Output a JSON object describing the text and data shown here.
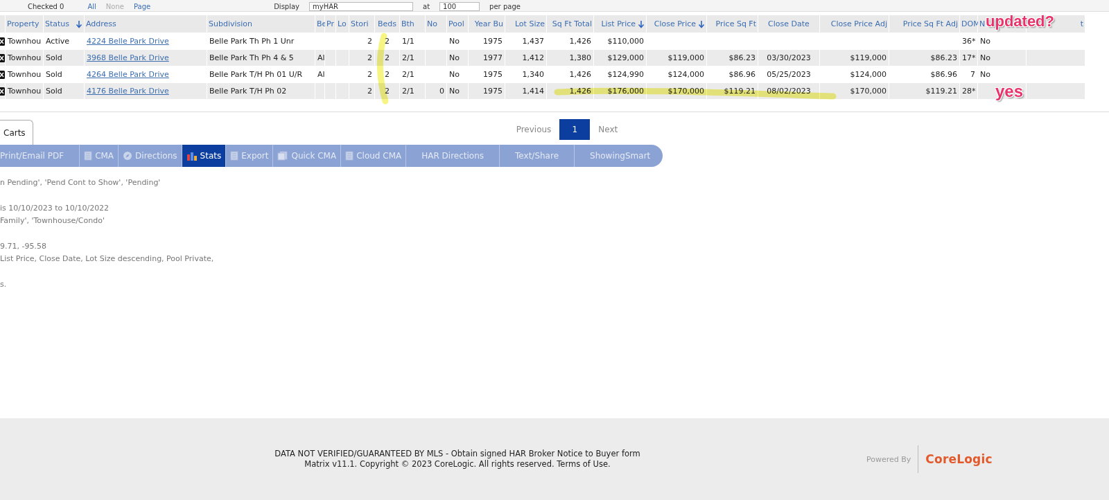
{
  "top_bar": {
    "checked_label": "Checked 0",
    "select_links": [
      "All",
      "None",
      "Page"
    ],
    "display_label": "Display",
    "display_value": "myHAR",
    "at_label": "at",
    "per_page_value": "100",
    "per_page_label": "per page"
  },
  "table": {
    "columns": [
      {
        "kind": "check",
        "sorted": false
      },
      {
        "label": "Property",
        "kind": "text",
        "sorted": false
      },
      {
        "label": "Status",
        "kind": "text",
        "sorted": true
      },
      {
        "label": "Address",
        "kind": "link",
        "sorted": false
      },
      {
        "label": "Subdivision",
        "kind": "text",
        "sorted": false
      },
      {
        "label": "Be",
        "kind": "text",
        "sorted": false
      },
      {
        "label": "Pr",
        "kind": "text",
        "sorted": false
      },
      {
        "label": "Lo",
        "kind": "text",
        "sorted": false
      },
      {
        "label": "Stori",
        "kind": "num",
        "sorted": false
      },
      {
        "label": "Beds",
        "kind": "center",
        "sorted": false
      },
      {
        "label": "Bth",
        "kind": "text",
        "sorted": false
      },
      {
        "label": "No",
        "kind": "num",
        "sorted": false
      },
      {
        "label": "Pool",
        "kind": "text",
        "sorted": false
      },
      {
        "label": "Year Bu",
        "kind": "num",
        "sorted": false
      },
      {
        "label": "Lot Size",
        "kind": "num",
        "sorted": false
      },
      {
        "label": "Sq Ft Total",
        "kind": "num",
        "sorted": false
      },
      {
        "label": "List Price",
        "kind": "num",
        "sorted": true
      },
      {
        "label": "Close Price",
        "kind": "num",
        "sorted": true
      },
      {
        "label": "Price Sq Ft",
        "kind": "num",
        "sorted": false
      },
      {
        "label": "Close Date",
        "kind": "center",
        "sorted": false
      },
      {
        "label": "Close Price Adj",
        "kind": "num",
        "sorted": false
      },
      {
        "label": "Price Sq Ft Adj",
        "kind": "num",
        "sorted": false
      },
      {
        "label": "DOM",
        "kind": "num",
        "sorted": false
      },
      {
        "label": "N",
        "kind": "text",
        "sorted": false
      },
      {
        "label": "t",
        "kind": "text",
        "sorted": false
      }
    ],
    "rows": [
      {
        "cells": [
          "",
          "Townhou",
          "Active",
          "4224 Belle Park Drive",
          "Belle Park Th Ph 1 Unr",
          "",
          "",
          "",
          "2",
          "2",
          "1/1",
          "",
          "No",
          "1975",
          "1,437",
          "1,426",
          "$110,000",
          "",
          "",
          "",
          "",
          "",
          "36*",
          "No",
          ""
        ]
      },
      {
        "cells": [
          "",
          "Townhou",
          "Sold",
          "3968 Belle Park Drive",
          "Belle Park Th Ph 4 & 5",
          "Al",
          "",
          "",
          "2",
          "2",
          "2/1",
          "",
          "No",
          "1977",
          "1,412",
          "1,380",
          "$129,000",
          "$119,000",
          "$86.23",
          "03/30/2023",
          "$119,000",
          "$86.23",
          "17*",
          "No",
          ""
        ]
      },
      {
        "cells": [
          "",
          "Townhou",
          "Sold",
          "4264 Belle Park Drive",
          "Belle Park T/H Ph 01 U/R",
          "Al",
          "",
          "",
          "2",
          "2",
          "2/1",
          "",
          "No",
          "1975",
          "1,340",
          "1,426",
          "$124,990",
          "$124,000",
          "$86.96",
          "05/25/2023",
          "$124,000",
          "$86.96",
          "7",
          "No",
          ""
        ]
      },
      {
        "cells": [
          "",
          "Townhou",
          "Sold",
          "4176 Belle Park Drive",
          "Belle Park T/H Ph 02",
          "",
          "",
          "",
          "2",
          "2",
          "2/1",
          "0",
          "No",
          "1975",
          "1,414",
          "1,426",
          "$176,000",
          "$170,000",
          "$119.21",
          "08/02/2023",
          "$170,000",
          "$119.21",
          "28*",
          "",
          ""
        ]
      }
    ]
  },
  "annotations": [
    {
      "text": "updated?"
    },
    {
      "text": "yes"
    }
  ],
  "tabs": [
    {
      "label": "Carts",
      "selected": true
    }
  ],
  "pager": {
    "previous": "Previous",
    "pages": [
      {
        "label": "1",
        "selected": true
      }
    ],
    "next": "Next"
  },
  "actions": [
    {
      "label": "Print/Email PDF",
      "kind": "plain",
      "selected": false
    },
    {
      "label": "CMA",
      "kind": "document",
      "selected": false
    },
    {
      "label": "Directions",
      "kind": "compass",
      "selected": false
    },
    {
      "label": "Stats",
      "kind": "chart",
      "selected": true
    },
    {
      "label": "Export",
      "kind": "document",
      "selected": false
    },
    {
      "label": "Quick CMA",
      "kind": "stack",
      "selected": false
    },
    {
      "label": "Cloud CMA",
      "kind": "document",
      "selected": false
    },
    {
      "label": "HAR Directions",
      "kind": "plain",
      "selected": false
    },
    {
      "label": "Text/Share",
      "kind": "plain",
      "selected": false
    },
    {
      "label": "ShowingSmart",
      "kind": "plain",
      "selected": false
    }
  ],
  "criteria": [
    [
      "n Pending', 'Pend Cont to Show', 'Pending'"
    ],
    [
      "is 10/10/2023 to 10/10/2022",
      "Family', 'Townhouse/Condo'"
    ],
    [
      "9.71, -95.58",
      "List Price, Close Date, Lot Size descending, Pool Private,"
    ],
    [
      "s."
    ]
  ],
  "footer": {
    "lines": [
      "DATA NOT VERIFIED/GUARANTEED BY MLS - Obtain signed HAR Broker Notice to Buyer form",
      "Matrix v11.1. Copyright © 2023 CoreLogic. All rights reserved. Terms of Use."
    ],
    "powered_by": "Powered By",
    "brand": "CoreLogic"
  }
}
